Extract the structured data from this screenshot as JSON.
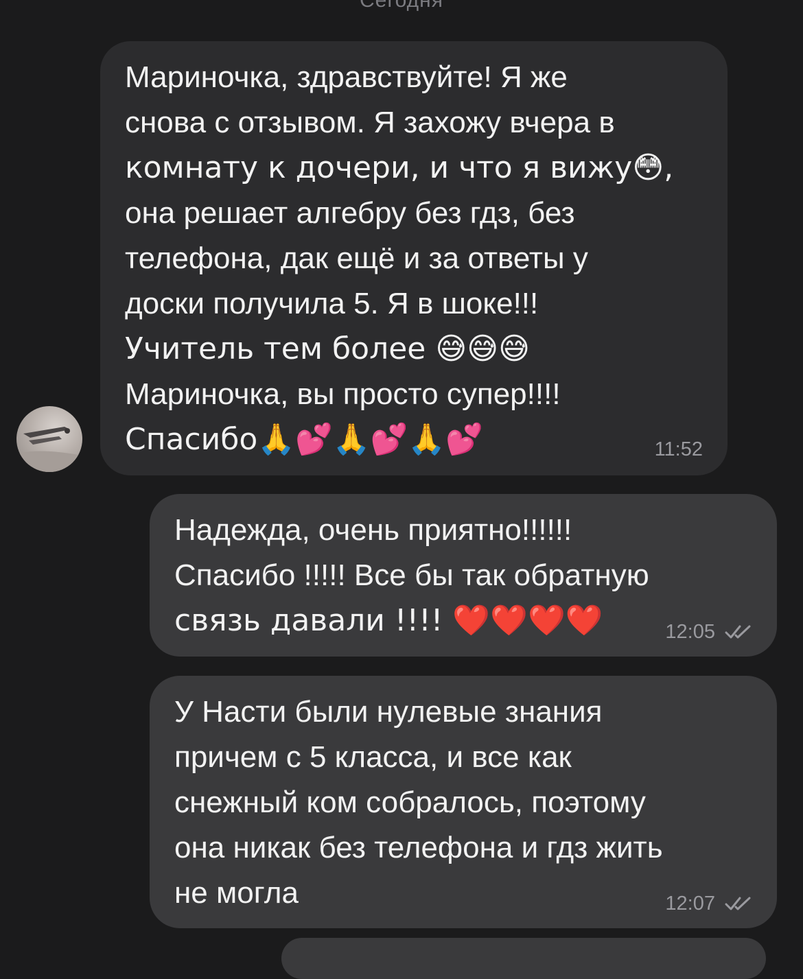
{
  "chat": {
    "date_label": "Сегодня",
    "messages": [
      {
        "direction": "incoming",
        "lines": [
          "Мариночка, здравствуйте! Я же",
          "снова с отзывом. Я захожу вчера в",
          "комнату к дочери, и что я вижу😳,",
          "она решает алгебру без гдз, без",
          "телефона, дак ещё и за ответы у",
          "доски получила 5.  Я в шоке!!!",
          "Учитель тем более 😅😅😅",
          "Мариночка, вы просто супер!!!!",
          "Спасибо🙏💕🙏💕🙏💕"
        ],
        "time": "11:52"
      },
      {
        "direction": "outgoing",
        "lines": [
          "Надежда, очень приятно!!!!!!",
          "Спасибо !!!!! Все бы так обратную",
          "связь давали !!!! ❤️❤️❤️❤️"
        ],
        "time": "12:05",
        "status_icon": "double-check-icon"
      },
      {
        "direction": "outgoing",
        "lines": [
          "У Насти были нулевые знания",
          "причем с 5 класса, и все как",
          "снежный ком собралось, поэтому",
          "она никак без телефона и гдз жить",
          "не могла"
        ],
        "time": "12:07",
        "status_icon": "double-check-icon"
      }
    ]
  },
  "colors": {
    "background": "#1b1b1c",
    "incoming_bubble": "#2c2c2e",
    "outgoing_bubble": "#3a3a3c",
    "text": "#f2f2f2",
    "meta": "#9a9a9f"
  }
}
